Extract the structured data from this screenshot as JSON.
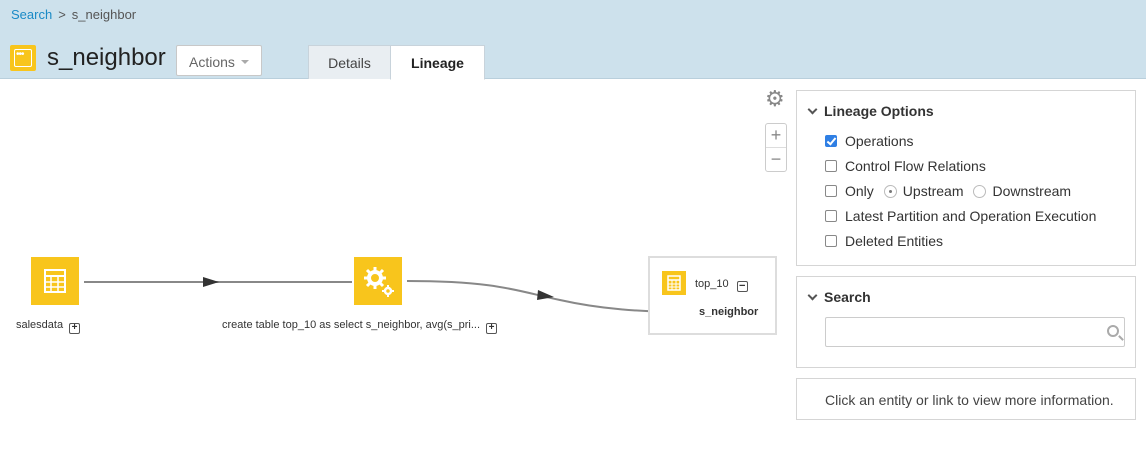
{
  "breadcrumb": {
    "root": "Search",
    "separator": ">",
    "current": "s_neighbor"
  },
  "entity": {
    "title": "s_neighbor",
    "icon": "view-entity-icon"
  },
  "actions": {
    "label": "Actions"
  },
  "tabs": [
    {
      "label": "Details",
      "active": false
    },
    {
      "label": "Lineage",
      "active": true
    }
  ],
  "lineage": {
    "nodes": [
      {
        "label": "salesdata",
        "icon": "table-icon"
      },
      {
        "label": "create table top_10 as select s_neighbor, avg(s_pri...",
        "icon": "gears-icon"
      }
    ],
    "target": {
      "label": "top_10",
      "column": "s_neighbor",
      "icon": "table-icon"
    }
  },
  "controls": {
    "settings_icon": "gear-icon",
    "zoom_in": "+",
    "zoom_out": "−"
  },
  "options": {
    "title": "Lineage Options",
    "items": [
      {
        "label": "Operations",
        "checked": true
      },
      {
        "label": "Control Flow Relations",
        "checked": false
      },
      {
        "label": "Only",
        "checked": false
      },
      {
        "label": "Latest Partition and Operation Execution",
        "checked": false
      },
      {
        "label": "Deleted Entities",
        "checked": false
      }
    ],
    "direction": {
      "upstream": "Upstream",
      "downstream": "Downstream",
      "selected": "Upstream"
    }
  },
  "search": {
    "title": "Search",
    "value": "",
    "placeholder": ""
  },
  "info": {
    "text": "Click an entity or link to view more information."
  },
  "colors": {
    "header_bg": "#cde1ec",
    "node_fill": "#f8c51c",
    "link": "#1a8ac6",
    "checkbox": "#2f7fe4",
    "edge": "#888888"
  }
}
